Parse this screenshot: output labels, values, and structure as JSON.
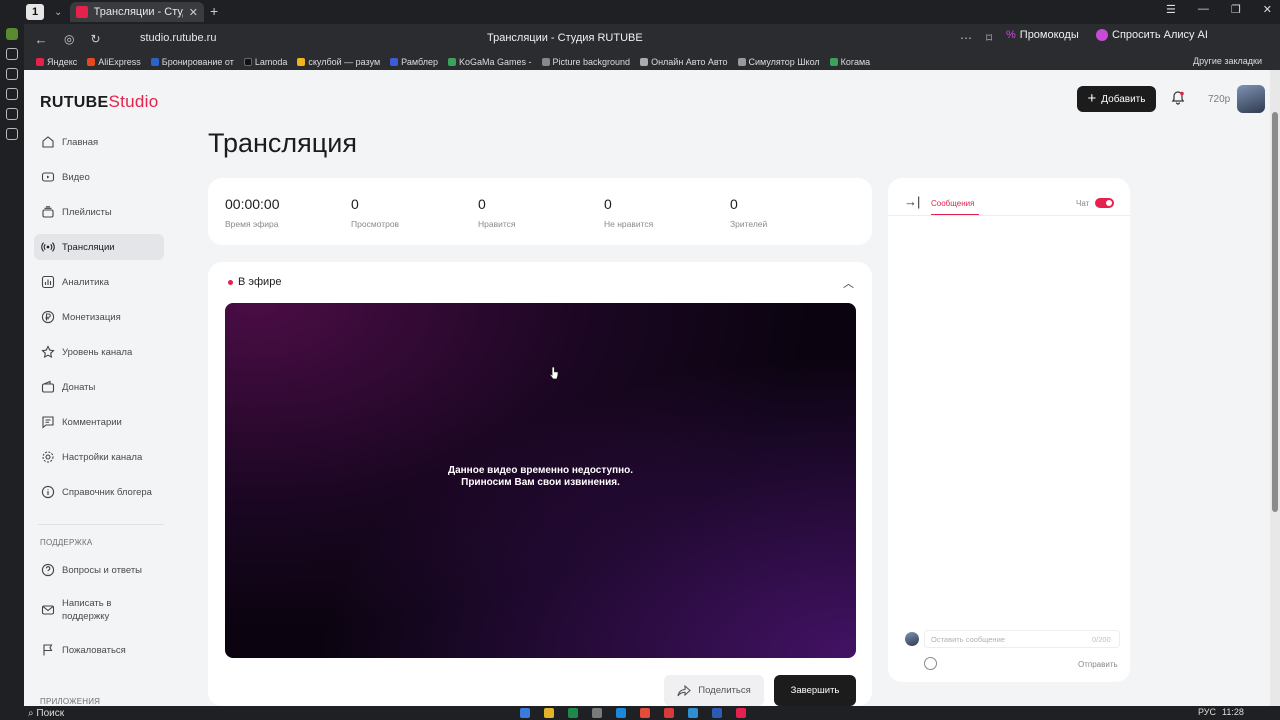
{
  "browser": {
    "tab_title": "Трансляции - Студия RUTUBE",
    "tab_count": "1",
    "url": "studio.rutube.ru",
    "page_title": "Трансляции - Студия RUTUBE",
    "promo_label": "Промокоды",
    "alice_label": "Спросить Алису AI",
    "bookmarks": [
      "Яндекс",
      "AliExpress",
      "Бронирование от",
      "Lamoda",
      "скулбой — разум",
      "Рамблер",
      "KoGaMa Games -",
      "Picture background",
      "Онлайн Авто Авто",
      "Симулятор Школ",
      "Когама"
    ],
    "bookmarks_other": "Другие закладки"
  },
  "header": {
    "logo_rutube": "RUTUBE",
    "logo_studio": "Studio",
    "add_label": "Добавить",
    "quality": "720p"
  },
  "sidebar": {
    "items": [
      {
        "label": "Главная"
      },
      {
        "label": "Видео"
      },
      {
        "label": "Плейлисты"
      },
      {
        "label": "Трансляции"
      },
      {
        "label": "Аналитика"
      },
      {
        "label": "Монетизация"
      },
      {
        "label": "Уровень канала"
      },
      {
        "label": "Донаты"
      },
      {
        "label": "Комментарии"
      },
      {
        "label": "Настройки канала"
      },
      {
        "label": "Справочник блогера"
      }
    ],
    "support_heading": "ПОДДЕРЖКА",
    "support_items": [
      {
        "label": "Вопросы и ответы"
      },
      {
        "label": "Написать в поддержку"
      },
      {
        "label": "Пожаловаться"
      }
    ],
    "apps_heading": "ПРИЛОЖЕНИЯ"
  },
  "main": {
    "title": "Трансляция",
    "stats": [
      {
        "value": "00:00:00",
        "label": "Время эфира"
      },
      {
        "value": "0",
        "label": "Просмотров"
      },
      {
        "value": "0",
        "label": "Нравится"
      },
      {
        "value": "0",
        "label": "Не нравится"
      },
      {
        "value": "0",
        "label": "Зрителей"
      }
    ],
    "live_label": "В эфире",
    "player_msg_1": "Данное видео временно недоступно.",
    "player_msg_2": "Приносим Вам свои извинения.",
    "share_label": "Поделиться",
    "end_label": "Завершить"
  },
  "chat": {
    "tab_messages": "Сообщения",
    "chat_label": "Чат",
    "chat_enabled": true,
    "input_placeholder": "Оставить сообщение",
    "counter": "0/200",
    "send_label": "Отправить"
  },
  "taskbar": {
    "search_label": "Поиск",
    "lang": "РУС",
    "time": "11:28"
  },
  "colors": {
    "accent": "#e5224b",
    "dark": "#1c1c1c"
  }
}
